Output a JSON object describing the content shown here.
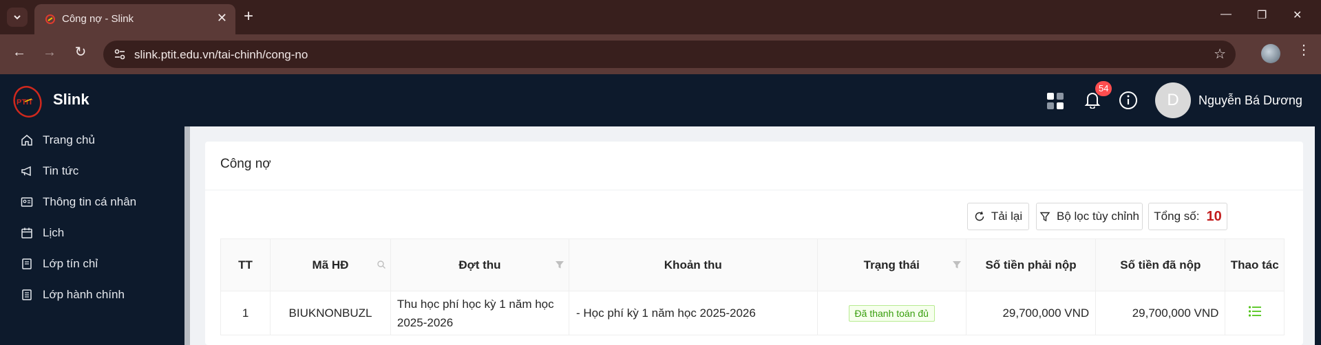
{
  "browser": {
    "tab_title": "Công nợ - Slink",
    "url": "slink.ptit.edu.vn/tai-chinh/cong-no"
  },
  "app": {
    "brand": "Slink",
    "logo_text": "PTIT",
    "notification_count": "54",
    "avatar_letter": "D",
    "user_name": "Nguyễn Bá Dương"
  },
  "sidebar": {
    "items": [
      {
        "label": "Trang chủ",
        "icon": "home-icon"
      },
      {
        "label": "Tin tức",
        "icon": "megaphone-icon"
      },
      {
        "label": "Thông tin cá nhân",
        "icon": "id-card-icon"
      },
      {
        "label": "Lịch",
        "icon": "calendar-icon"
      },
      {
        "label": "Lớp tín chỉ",
        "icon": "book-icon"
      },
      {
        "label": "Lớp hành chính",
        "icon": "book-icon"
      }
    ]
  },
  "page": {
    "title": "Công nợ",
    "reload_label": "Tải lại",
    "filter_label": "Bộ lọc tùy chỉnh",
    "total_label": "Tổng số:",
    "total_value": "10"
  },
  "table": {
    "headers": [
      "TT",
      "Mã HĐ",
      "Đợt thu",
      "Khoản thu",
      "Trạng thái",
      "Số tiền phải nộp",
      "Số tiền đã nộp",
      "Thao tác"
    ],
    "rows": [
      {
        "tt": "1",
        "ma_hd": "BIUKNONBUZL",
        "dot_thu": "Thu học phí học kỳ 1 năm học 2025-2026",
        "khoan_thu": "- Học phí kỳ 1 năm học 2025-2026",
        "trang_thai": "Đã thanh toán đủ",
        "phai_nop": "29,700,000 VND",
        "da_nop": "29,700,000 VND"
      }
    ]
  },
  "colors": {
    "browser_frame": "#381f1d",
    "browser_toolbar": "#5b3a37",
    "app_dark": "#0d1a2c",
    "total_red": "#c21b1b",
    "status_green": "#389e0d",
    "action_green": "#52c41a"
  }
}
